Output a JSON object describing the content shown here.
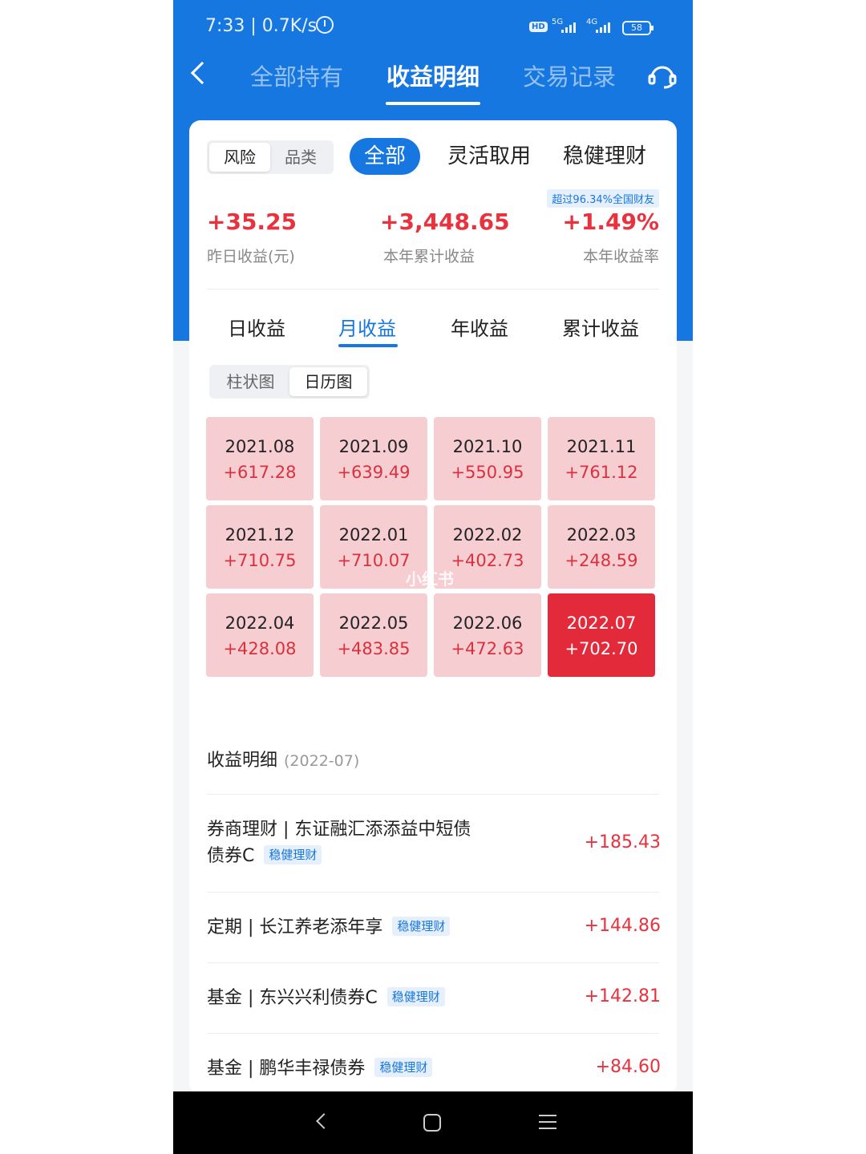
{
  "status_bar": {
    "time": "7:33 | 0.7K/s",
    "hd": "HD",
    "net1": "5G",
    "net2": "4G",
    "battery": "58"
  },
  "header": {
    "tabs": [
      "全部持有",
      "收益明细",
      "交易记录"
    ],
    "active_tab": 1
  },
  "filters": {
    "segment": [
      "风险",
      "品类"
    ],
    "pills": [
      "全部",
      "灵活取用",
      "稳健理财"
    ]
  },
  "summary": {
    "badge": "超过96.34%全国财友",
    "stats": [
      {
        "value": "+35.25",
        "label": "昨日收益(元)"
      },
      {
        "value": "+3,448.65",
        "label": "本年累计收益"
      },
      {
        "value": "+1.49%",
        "label": "本年收益率"
      }
    ]
  },
  "period_tabs": [
    "日收益",
    "月收益",
    "年收益",
    "累计收益"
  ],
  "view_toggle": [
    "柱状图",
    "日历图"
  ],
  "months": [
    {
      "month": "2021.08",
      "value": "+617.28"
    },
    {
      "month": "2021.09",
      "value": "+639.49"
    },
    {
      "month": "2021.10",
      "value": "+550.95"
    },
    {
      "month": "2021.11",
      "value": "+761.12"
    },
    {
      "month": "2021.12",
      "value": "+710.75"
    },
    {
      "month": "2022.01",
      "value": "+710.07"
    },
    {
      "month": "2022.02",
      "value": "+402.73"
    },
    {
      "month": "2022.03",
      "value": "+248.59"
    },
    {
      "month": "2022.04",
      "value": "+428.08"
    },
    {
      "month": "2022.05",
      "value": "+483.85"
    },
    {
      "month": "2022.06",
      "value": "+472.63"
    },
    {
      "month": "2022.07",
      "value": "+702.70"
    }
  ],
  "watermark": "小红书",
  "detail": {
    "title": "收益明细",
    "date": "(2022-07)",
    "rows": [
      {
        "name_line1": "券商理财 | 东证融汇添添益中短债",
        "name_line2": "债券C",
        "tag": "稳健理财",
        "amount": "+185.43"
      },
      {
        "name_line1": "定期 | 长江养老添年享",
        "tag": "稳健理财",
        "amount": "+144.86"
      },
      {
        "name_line1": "基金 | 东兴兴利债券C",
        "tag": "稳健理财",
        "amount": "+142.81"
      },
      {
        "name_line1": "基金 | 鹏华丰禄债券",
        "tag": "稳健理财",
        "amount": "+84.60"
      }
    ]
  },
  "colors": {
    "brand_blue": "#1677e0",
    "gain_red": "#e8323e",
    "cell_pink": "#f6cdd1",
    "cell_selected": "#e22a3a"
  },
  "icons": [
    "back-arrow-icon",
    "alarm-icon",
    "customer-service-icon",
    "nav-back-icon",
    "nav-home-icon",
    "nav-menu-icon"
  ]
}
